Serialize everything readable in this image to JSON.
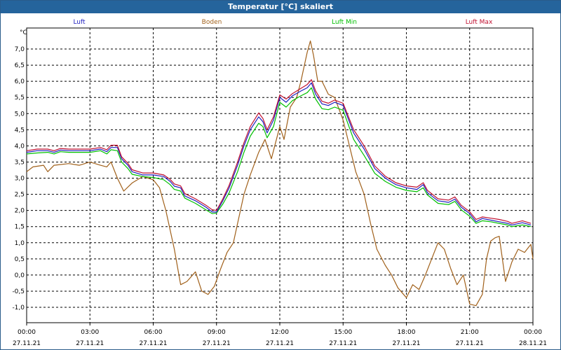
{
  "window": {
    "title": "Temperatur [°C] skaliert"
  },
  "chart_data": {
    "type": "line",
    "title": "Temperatur [°C] skaliert",
    "ylabel": "°C",
    "xlabel": "",
    "ylim": [
      -1.5,
      7.5
    ],
    "y_ticks": [
      "7,0",
      "6,5",
      "6,0",
      "5,5",
      "5,0",
      "4,5",
      "4,0",
      "3,5",
      "3,0",
      "2,5",
      "2,0",
      "1,5",
      "1,0",
      "0,5",
      "0,0",
      "-0,5",
      "-1,0"
    ],
    "x_ticks": [
      {
        "time": "00:00",
        "date": "27.11.21"
      },
      {
        "time": "03:00",
        "date": "27.11.21"
      },
      {
        "time": "06:00",
        "date": "27.11.21"
      },
      {
        "time": "09:00",
        "date": "27.11.21"
      },
      {
        "time": "12:00",
        "date": "27.11.21"
      },
      {
        "time": "15:00",
        "date": "27.11.21"
      },
      {
        "time": "18:00",
        "date": "27.11.21"
      },
      {
        "time": "21:00",
        "date": "27.11.21"
      },
      {
        "time": "00:00",
        "date": "28.11.21"
      }
    ],
    "x_unit": "hours",
    "xlim": [
      0,
      24
    ],
    "grid": true,
    "legend_position": "top",
    "series": [
      {
        "name": "Luft",
        "color": "#1f1fbf",
        "points": [
          [
            0,
            3.8
          ],
          [
            0.5,
            3.85
          ],
          [
            1,
            3.85
          ],
          [
            1.3,
            3.8
          ],
          [
            1.6,
            3.87
          ],
          [
            2,
            3.85
          ],
          [
            3,
            3.85
          ],
          [
            3.5,
            3.9
          ],
          [
            3.8,
            3.82
          ],
          [
            4,
            3.95
          ],
          [
            4.3,
            3.95
          ],
          [
            4.5,
            3.6
          ],
          [
            4.8,
            3.4
          ],
          [
            5,
            3.2
          ],
          [
            5.5,
            3.1
          ],
          [
            6,
            3.1
          ],
          [
            6.5,
            3.05
          ],
          [
            6.8,
            2.9
          ],
          [
            7,
            2.75
          ],
          [
            7.3,
            2.7
          ],
          [
            7.5,
            2.45
          ],
          [
            8,
            2.3
          ],
          [
            8.5,
            2.1
          ],
          [
            8.8,
            1.95
          ],
          [
            9,
            1.95
          ],
          [
            9.3,
            2.3
          ],
          [
            9.6,
            2.7
          ],
          [
            10,
            3.4
          ],
          [
            10.3,
            4.0
          ],
          [
            10.6,
            4.5
          ],
          [
            11,
            4.9
          ],
          [
            11.2,
            4.75
          ],
          [
            11.4,
            4.4
          ],
          [
            11.7,
            4.8
          ],
          [
            12,
            5.5
          ],
          [
            12.3,
            5.35
          ],
          [
            12.6,
            5.55
          ],
          [
            13,
            5.7
          ],
          [
            13.3,
            5.8
          ],
          [
            13.5,
            5.95
          ],
          [
            13.7,
            5.6
          ],
          [
            14,
            5.3
          ],
          [
            14.3,
            5.25
          ],
          [
            14.6,
            5.35
          ],
          [
            15,
            5.25
          ],
          [
            15.5,
            4.4
          ],
          [
            16,
            3.9
          ],
          [
            16.5,
            3.3
          ],
          [
            17,
            3.0
          ],
          [
            17.5,
            2.8
          ],
          [
            18,
            2.7
          ],
          [
            18.5,
            2.65
          ],
          [
            18.8,
            2.8
          ],
          [
            19,
            2.55
          ],
          [
            19.5,
            2.3
          ],
          [
            20,
            2.25
          ],
          [
            20.3,
            2.35
          ],
          [
            20.6,
            2.1
          ],
          [
            21,
            1.9
          ],
          [
            21.3,
            1.65
          ],
          [
            21.6,
            1.75
          ],
          [
            22,
            1.7
          ],
          [
            22.4,
            1.65
          ],
          [
            22.8,
            1.6
          ],
          [
            23,
            1.55
          ],
          [
            23.5,
            1.62
          ],
          [
            23.9,
            1.55
          ]
        ]
      },
      {
        "name": "Boden",
        "color": "#a0601a",
        "points": [
          [
            0,
            3.2
          ],
          [
            0.3,
            3.35
          ],
          [
            0.8,
            3.4
          ],
          [
            1,
            3.2
          ],
          [
            1.3,
            3.4
          ],
          [
            2,
            3.45
          ],
          [
            2.5,
            3.4
          ],
          [
            3,
            3.5
          ],
          [
            3.5,
            3.4
          ],
          [
            3.8,
            3.35
          ],
          [
            4,
            3.5
          ],
          [
            4.3,
            3.0
          ],
          [
            4.6,
            2.6
          ],
          [
            5,
            2.85
          ],
          [
            5.5,
            3.05
          ],
          [
            6,
            2.95
          ],
          [
            6.3,
            2.7
          ],
          [
            6.6,
            2.0
          ],
          [
            7,
            0.8
          ],
          [
            7.3,
            -0.3
          ],
          [
            7.6,
            -0.2
          ],
          [
            8,
            0.1
          ],
          [
            8.3,
            -0.5
          ],
          [
            8.6,
            -0.6
          ],
          [
            8.9,
            -0.35
          ],
          [
            9.2,
            0.2
          ],
          [
            9.5,
            0.7
          ],
          [
            9.8,
            1.0
          ],
          [
            10,
            1.6
          ],
          [
            10.3,
            2.5
          ],
          [
            10.6,
            3.1
          ],
          [
            11,
            3.8
          ],
          [
            11.3,
            4.2
          ],
          [
            11.6,
            3.6
          ],
          [
            12,
            4.6
          ],
          [
            12.2,
            4.2
          ],
          [
            12.5,
            5.2
          ],
          [
            12.8,
            5.5
          ],
          [
            13,
            6.0
          ],
          [
            13.3,
            6.9
          ],
          [
            13.45,
            7.25
          ],
          [
            13.6,
            6.8
          ],
          [
            13.8,
            6.0
          ],
          [
            14,
            6.0
          ],
          [
            14.3,
            5.6
          ],
          [
            14.6,
            5.5
          ],
          [
            15,
            4.8
          ],
          [
            15.3,
            4.0
          ],
          [
            15.6,
            3.2
          ],
          [
            16,
            2.5
          ],
          [
            16.3,
            1.6
          ],
          [
            16.6,
            0.8
          ],
          [
            17,
            0.3
          ],
          [
            17.3,
            0.0
          ],
          [
            17.6,
            -0.4
          ],
          [
            18,
            -0.7
          ],
          [
            18.3,
            -0.3
          ],
          [
            18.6,
            -0.45
          ],
          [
            18.9,
            0.0
          ],
          [
            19.2,
            0.5
          ],
          [
            19.5,
            1.0
          ],
          [
            19.8,
            0.8
          ],
          [
            20.1,
            0.2
          ],
          [
            20.4,
            -0.3
          ],
          [
            20.7,
            0.0
          ],
          [
            21,
            -0.9
          ],
          [
            21.3,
            -0.95
          ],
          [
            21.6,
            -0.6
          ],
          [
            21.8,
            0.5
          ],
          [
            22,
            1.05
          ],
          [
            22.2,
            1.15
          ],
          [
            22.4,
            1.2
          ],
          [
            22.7,
            -0.2
          ],
          [
            23,
            0.4
          ],
          [
            23.3,
            0.8
          ],
          [
            23.6,
            0.7
          ],
          [
            23.9,
            0.95
          ],
          [
            24,
            0.5
          ]
        ]
      },
      {
        "name": "Luft Min",
        "color": "#00c000",
        "points": [
          [
            0,
            3.75
          ],
          [
            0.5,
            3.78
          ],
          [
            1,
            3.8
          ],
          [
            1.3,
            3.75
          ],
          [
            1.6,
            3.82
          ],
          [
            2,
            3.8
          ],
          [
            3,
            3.8
          ],
          [
            3.5,
            3.85
          ],
          [
            3.8,
            3.75
          ],
          [
            4,
            3.88
          ],
          [
            4.3,
            3.85
          ],
          [
            4.5,
            3.5
          ],
          [
            4.8,
            3.3
          ],
          [
            5,
            3.12
          ],
          [
            5.5,
            3.05
          ],
          [
            6,
            3.02
          ],
          [
            6.5,
            2.95
          ],
          [
            6.8,
            2.8
          ],
          [
            7,
            2.65
          ],
          [
            7.3,
            2.6
          ],
          [
            7.5,
            2.38
          ],
          [
            8,
            2.22
          ],
          [
            8.5,
            2.02
          ],
          [
            8.8,
            1.9
          ],
          [
            9,
            1.92
          ],
          [
            9.3,
            2.2
          ],
          [
            9.6,
            2.55
          ],
          [
            10,
            3.2
          ],
          [
            10.3,
            3.8
          ],
          [
            10.6,
            4.3
          ],
          [
            11,
            4.7
          ],
          [
            11.2,
            4.6
          ],
          [
            11.4,
            4.25
          ],
          [
            11.7,
            4.6
          ],
          [
            12,
            5.35
          ],
          [
            12.3,
            5.2
          ],
          [
            12.6,
            5.4
          ],
          [
            13,
            5.55
          ],
          [
            13.3,
            5.65
          ],
          [
            13.5,
            5.8
          ],
          [
            13.7,
            5.45
          ],
          [
            14,
            5.15
          ],
          [
            14.3,
            5.12
          ],
          [
            14.6,
            5.2
          ],
          [
            15,
            5.1
          ],
          [
            15.5,
            4.2
          ],
          [
            16,
            3.7
          ],
          [
            16.5,
            3.15
          ],
          [
            17,
            2.9
          ],
          [
            17.5,
            2.72
          ],
          [
            18,
            2.62
          ],
          [
            18.5,
            2.58
          ],
          [
            18.8,
            2.7
          ],
          [
            19,
            2.48
          ],
          [
            19.5,
            2.22
          ],
          [
            20,
            2.18
          ],
          [
            20.3,
            2.28
          ],
          [
            20.6,
            2.02
          ],
          [
            21,
            1.82
          ],
          [
            21.3,
            1.6
          ],
          [
            21.6,
            1.68
          ],
          [
            22,
            1.65
          ],
          [
            22.4,
            1.6
          ],
          [
            22.8,
            1.55
          ],
          [
            23,
            1.5
          ],
          [
            23.5,
            1.55
          ],
          [
            23.9,
            1.5
          ]
        ]
      },
      {
        "name": "Luft Max",
        "color": "#c01030",
        "points": [
          [
            0,
            3.85
          ],
          [
            0.5,
            3.9
          ],
          [
            1,
            3.9
          ],
          [
            1.3,
            3.85
          ],
          [
            1.6,
            3.92
          ],
          [
            2,
            3.9
          ],
          [
            3,
            3.9
          ],
          [
            3.5,
            3.95
          ],
          [
            3.8,
            3.88
          ],
          [
            4,
            4.02
          ],
          [
            4.3,
            4.02
          ],
          [
            4.5,
            3.66
          ],
          [
            4.8,
            3.46
          ],
          [
            5,
            3.26
          ],
          [
            5.5,
            3.16
          ],
          [
            6,
            3.16
          ],
          [
            6.5,
            3.1
          ],
          [
            6.8,
            2.96
          ],
          [
            7,
            2.82
          ],
          [
            7.3,
            2.76
          ],
          [
            7.5,
            2.52
          ],
          [
            8,
            2.36
          ],
          [
            8.5,
            2.16
          ],
          [
            8.8,
            2.02
          ],
          [
            9,
            2.0
          ],
          [
            9.3,
            2.36
          ],
          [
            9.6,
            2.78
          ],
          [
            10,
            3.5
          ],
          [
            10.3,
            4.1
          ],
          [
            10.6,
            4.6
          ],
          [
            11,
            5.02
          ],
          [
            11.2,
            4.85
          ],
          [
            11.4,
            4.5
          ],
          [
            11.7,
            4.9
          ],
          [
            12,
            5.58
          ],
          [
            12.3,
            5.45
          ],
          [
            12.6,
            5.62
          ],
          [
            13,
            5.78
          ],
          [
            13.3,
            5.9
          ],
          [
            13.5,
            6.05
          ],
          [
            13.7,
            5.7
          ],
          [
            14,
            5.38
          ],
          [
            14.3,
            5.32
          ],
          [
            14.6,
            5.42
          ],
          [
            15,
            5.32
          ],
          [
            15.5,
            4.5
          ],
          [
            16,
            4.0
          ],
          [
            16.5,
            3.38
          ],
          [
            17,
            3.06
          ],
          [
            17.5,
            2.86
          ],
          [
            18,
            2.76
          ],
          [
            18.5,
            2.72
          ],
          [
            18.8,
            2.86
          ],
          [
            19,
            2.62
          ],
          [
            19.5,
            2.36
          ],
          [
            20,
            2.32
          ],
          [
            20.3,
            2.42
          ],
          [
            20.6,
            2.16
          ],
          [
            21,
            1.96
          ],
          [
            21.3,
            1.72
          ],
          [
            21.6,
            1.8
          ],
          [
            22,
            1.76
          ],
          [
            22.4,
            1.72
          ],
          [
            22.8,
            1.66
          ],
          [
            23,
            1.6
          ],
          [
            23.5,
            1.68
          ],
          [
            23.9,
            1.6
          ]
        ]
      }
    ]
  }
}
